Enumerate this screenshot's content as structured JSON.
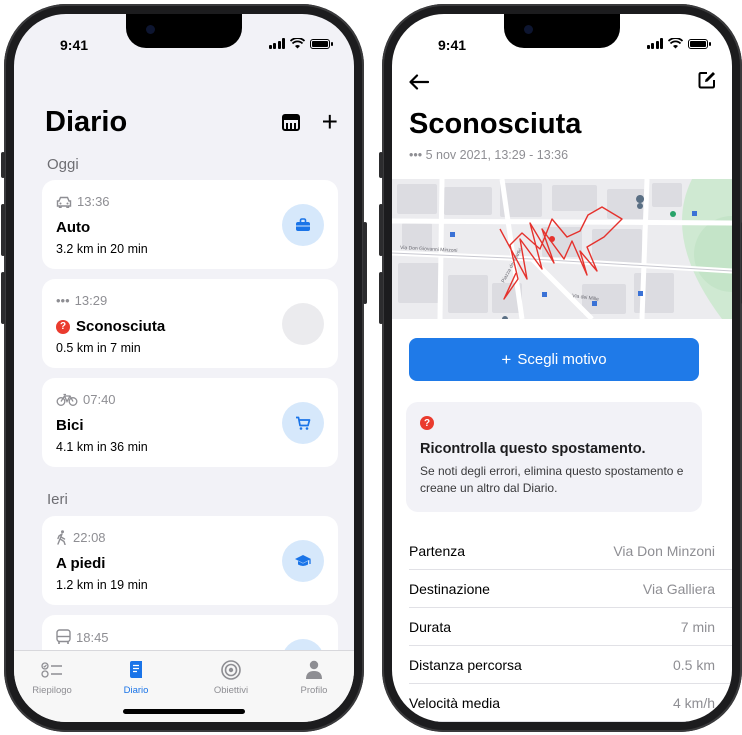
{
  "status": {
    "time": "9:41"
  },
  "diario": {
    "title": "Diario",
    "sections": [
      {
        "label": "Oggi",
        "trips": [
          {
            "time": "13:36",
            "mode_icon": "car-icon",
            "name": "Auto",
            "detail": "3.2 km in 20 min",
            "purpose_icon": "briefcase-icon"
          },
          {
            "time": "13:29",
            "mode_icon": "dots-icon",
            "name": "Sconosciuta",
            "detail": "0.5 km in 7 min",
            "purpose_icon": "none",
            "unknown": true
          },
          {
            "time": "07:40",
            "mode_icon": "bicycle-icon",
            "name": "Bici",
            "detail": "4.1 km in 36 min",
            "purpose_icon": "cart-icon"
          }
        ]
      },
      {
        "label": "Ieri",
        "trips": [
          {
            "time": "22:08",
            "mode_icon": "walk-icon",
            "name": "A piedi",
            "detail": "1.2 km in 19 min",
            "purpose_icon": "graduation-cap-icon"
          },
          {
            "time": "18:45",
            "mode_icon": "bus-icon",
            "name": "",
            "detail": "",
            "purpose_icon": ""
          }
        ]
      }
    ],
    "tabs": [
      {
        "label": "Riepilogo",
        "icon": "summary-icon"
      },
      {
        "label": "Diario",
        "icon": "diary-icon",
        "active": true
      },
      {
        "label": "Obiettivi",
        "icon": "target-icon"
      },
      {
        "label": "Profilo",
        "icon": "person-icon"
      }
    ]
  },
  "detail": {
    "title": "Sconosciuta",
    "subtitle": "••• 5 nov 2021, 13:29 - 13:36",
    "map_labels": [
      "Via Don Giovanni Minzoni",
      "Piazza dei Martiri",
      "Via dei Mille"
    ],
    "cta_label": "Scegli motivo",
    "warning_title": "Ricontrolla questo spostamento.",
    "warning_body": "Se noti degli errori, elimina questo spostamento e creane un altro dal Diario.",
    "rows": [
      {
        "key": "Partenza",
        "value": "Via Don Minzoni"
      },
      {
        "key": "Destinazione",
        "value": "Via Galliera"
      },
      {
        "key": "Durata",
        "value": "7 min"
      },
      {
        "key": "Distanza percorsa",
        "value": "0.5 km"
      },
      {
        "key": "Velocità media",
        "value": "4 km/h"
      }
    ]
  },
  "colors": {
    "accent": "#1f7ae8",
    "warning": "#ea3b2e",
    "route": "#e5322d"
  }
}
